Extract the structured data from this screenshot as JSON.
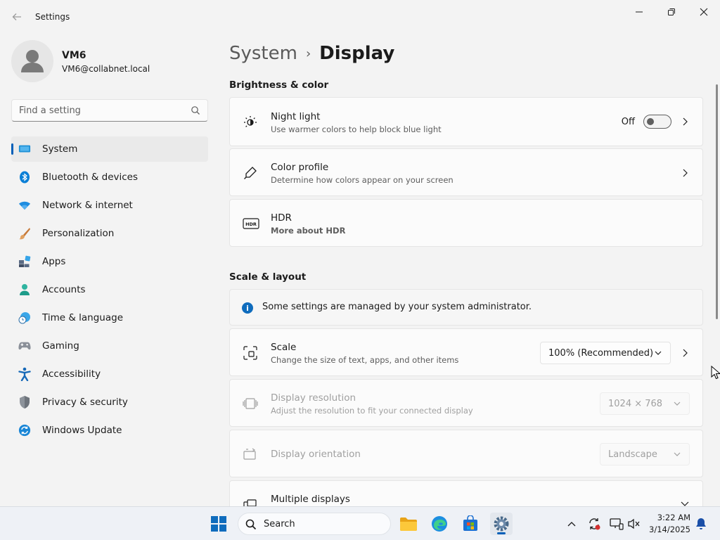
{
  "window": {
    "title": "Settings"
  },
  "user": {
    "name": "VM6",
    "email": "VM6@collabnet.local"
  },
  "search": {
    "placeholder": "Find a setting"
  },
  "sidebar": {
    "items": [
      {
        "label": "System",
        "icon": "monitor-icon",
        "selected": true
      },
      {
        "label": "Bluetooth & devices",
        "icon": "bluetooth-icon"
      },
      {
        "label": "Network & internet",
        "icon": "wifi-icon"
      },
      {
        "label": "Personalization",
        "icon": "brush-icon"
      },
      {
        "label": "Apps",
        "icon": "apps-icon"
      },
      {
        "label": "Accounts",
        "icon": "person-icon"
      },
      {
        "label": "Time & language",
        "icon": "globe-clock-icon"
      },
      {
        "label": "Gaming",
        "icon": "gamepad-icon"
      },
      {
        "label": "Accessibility",
        "icon": "accessibility-icon"
      },
      {
        "label": "Privacy & security",
        "icon": "shield-icon"
      },
      {
        "label": "Windows Update",
        "icon": "update-icon"
      }
    ]
  },
  "breadcrumb": {
    "parent": "System",
    "separator": "›",
    "current": "Display"
  },
  "sections": {
    "brightness": "Brightness & color",
    "scale": "Scale & layout"
  },
  "night_light": {
    "title": "Night light",
    "subtitle": "Use warmer colors to help block blue light",
    "state": "Off"
  },
  "color_profile": {
    "title": "Color profile",
    "subtitle": "Determine how colors appear on your screen"
  },
  "hdr": {
    "title": "HDR",
    "link": "More about HDR",
    "icon_text": "HDR"
  },
  "admin_info": {
    "text": "Some settings are managed by your system administrator."
  },
  "scale": {
    "title": "Scale",
    "subtitle": "Change the size of text, apps, and other items",
    "value": "100% (Recommended)"
  },
  "resolution": {
    "title": "Display resolution",
    "subtitle": "Adjust the resolution to fit your connected display",
    "value": "1024 × 768"
  },
  "orientation": {
    "title": "Display orientation",
    "value": "Landscape"
  },
  "multiple": {
    "title": "Multiple displays"
  },
  "taskbar": {
    "search_label": "Search",
    "time": "3:22 AM",
    "date": "3/14/2025"
  },
  "colors": {
    "accent": "#005fb8",
    "link": "#0f5ba8"
  }
}
